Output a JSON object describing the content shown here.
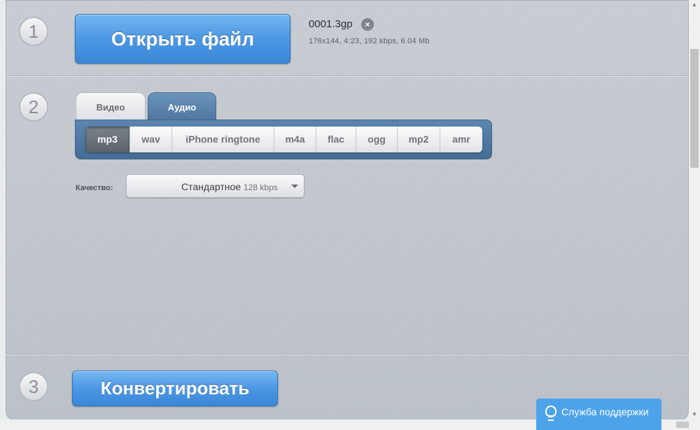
{
  "steps": {
    "one": "1",
    "two": "2",
    "three": "3"
  },
  "open_button": "Открыть файл",
  "file": {
    "name": "0001.3gp",
    "info": "176x144, 4:23, 192 kbps, 6.04 Mb",
    "remove_icon": "×"
  },
  "tabs": [
    {
      "label": "Видео",
      "active": false
    },
    {
      "label": "Аудио",
      "active": true
    }
  ],
  "formats": [
    {
      "label": "mp3",
      "active": true
    },
    {
      "label": "wav"
    },
    {
      "label": "iPhone ringtone"
    },
    {
      "label": "m4a"
    },
    {
      "label": "flac"
    },
    {
      "label": "ogg"
    },
    {
      "label": "mp2"
    },
    {
      "label": "amr"
    }
  ],
  "quality": {
    "label": "Качество:",
    "value": "Стандартное",
    "detail": "128 kbps"
  },
  "convert_button": "Конвертировать",
  "support": {
    "label": "Служба поддержки"
  },
  "scrollbar": {
    "up": "▲",
    "down": "▼"
  },
  "colors": {
    "accent_blue": "#4d98e4",
    "tab_active": "#5c86b0",
    "support": "#4da3ea"
  }
}
